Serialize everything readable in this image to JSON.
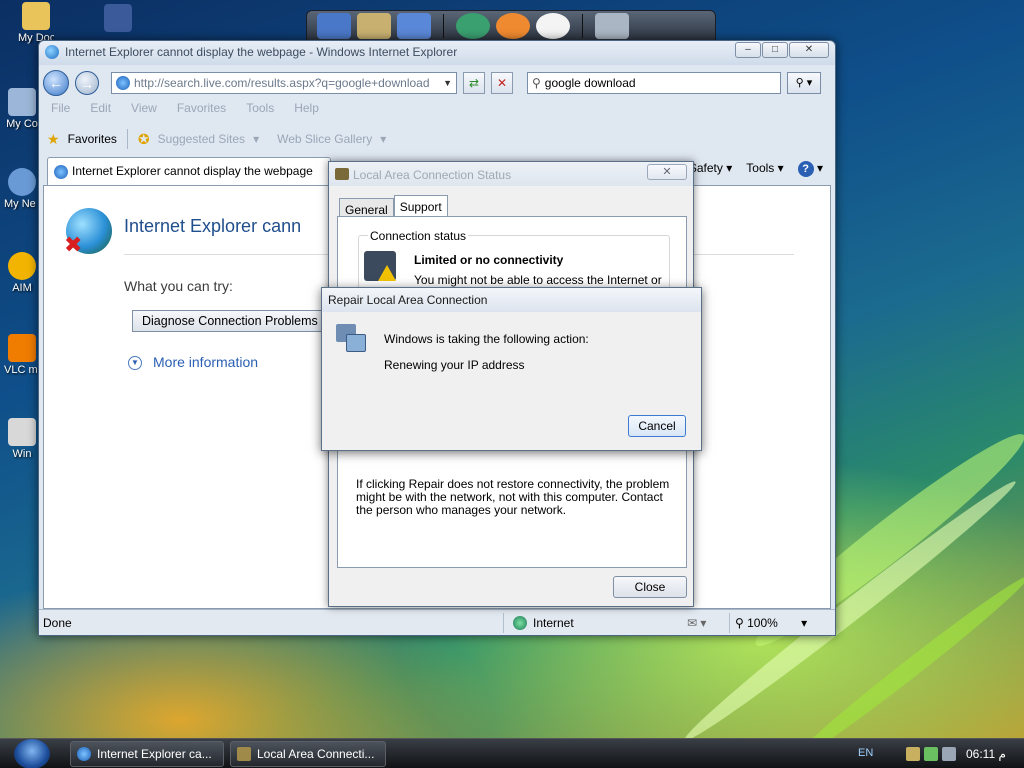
{
  "desktop": {
    "icons": [
      {
        "label": "My Docu"
      },
      {
        "label": "My Co"
      },
      {
        "label": "My Ne Pla"
      },
      {
        "label": "AIM"
      },
      {
        "label": "VLC m pla"
      },
      {
        "label": "Win"
      }
    ]
  },
  "ie": {
    "title": "Internet Explorer cannot display the webpage - Windows Internet Explorer",
    "controls": {
      "minimize": "–",
      "maximize": "□",
      "close": "✕"
    },
    "address": "http://search.live.com/results.aspx?q=google+download",
    "search_value": "google download",
    "menu": [
      "File",
      "Edit",
      "View",
      "Favorites",
      "Tools",
      "Help"
    ],
    "favorites_bar": {
      "favorites": "Favorites",
      "suggested": "Suggested Sites",
      "gallery": "Web Slice Gallery"
    },
    "tab_title": "Internet Explorer cannot display the webpage",
    "tab_tools": {
      "safety": "Safety",
      "tools": "Tools",
      "help": "?"
    },
    "page": {
      "heading": "Internet Explorer cann",
      "try_label": "What you can try:",
      "diagnose_button": "Diagnose Connection Problems",
      "more_info": "More information"
    },
    "status": {
      "done": "Done",
      "zone": "Internet",
      "zoom": "100%"
    }
  },
  "lac_dialog": {
    "title": "Local Area Connection Status",
    "tabs": [
      "General",
      "Support"
    ],
    "active_tab": "Support",
    "group_label": "Connection status",
    "status_heading": "Limited or no connectivity",
    "status_sub": "You might not be able to access the Internet or some",
    "note": "If clicking Repair does not restore connectivity, the problem might be with the network, not with this computer. Contact the person who manages your network.",
    "close_button": "Close"
  },
  "repair_dialog": {
    "title": "Repair Local Area Connection",
    "line1": "Windows is taking the following action:",
    "line2": "Renewing your IP address",
    "cancel_button": "Cancel"
  },
  "taskbar": {
    "buttons": [
      "Internet Explorer ca...",
      "Local Area Connecti..."
    ],
    "language": "EN",
    "clock": "06:11 م"
  }
}
